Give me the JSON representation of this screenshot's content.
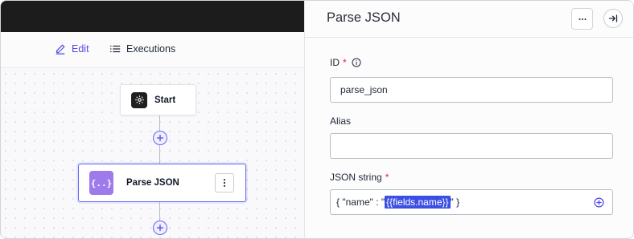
{
  "toolbar": {
    "edit_label": "Edit",
    "executions_label": "Executions"
  },
  "canvas": {
    "start_node": {
      "label": "Start",
      "icon": "gear-icon"
    },
    "parse_node": {
      "label": "Parse JSON",
      "icon_text": "{..}"
    }
  },
  "panel": {
    "title": "Parse JSON",
    "fields": {
      "id": {
        "label": "ID",
        "required_mark": "*",
        "value": "parse_json"
      },
      "alias": {
        "label": "Alias",
        "value": ""
      },
      "json_string": {
        "label": "JSON string",
        "required_mark": "*",
        "prefix": "{ \"name\" : \"",
        "token": "{{fields.name}}",
        "suffix": "\" }"
      }
    }
  },
  "colors": {
    "accent": "#4f46e5",
    "token_bg": "#3b4fe4",
    "parse_icon_bg": "#9f7aea",
    "required": "#e11d48",
    "topbar": "#1c1c1c"
  }
}
